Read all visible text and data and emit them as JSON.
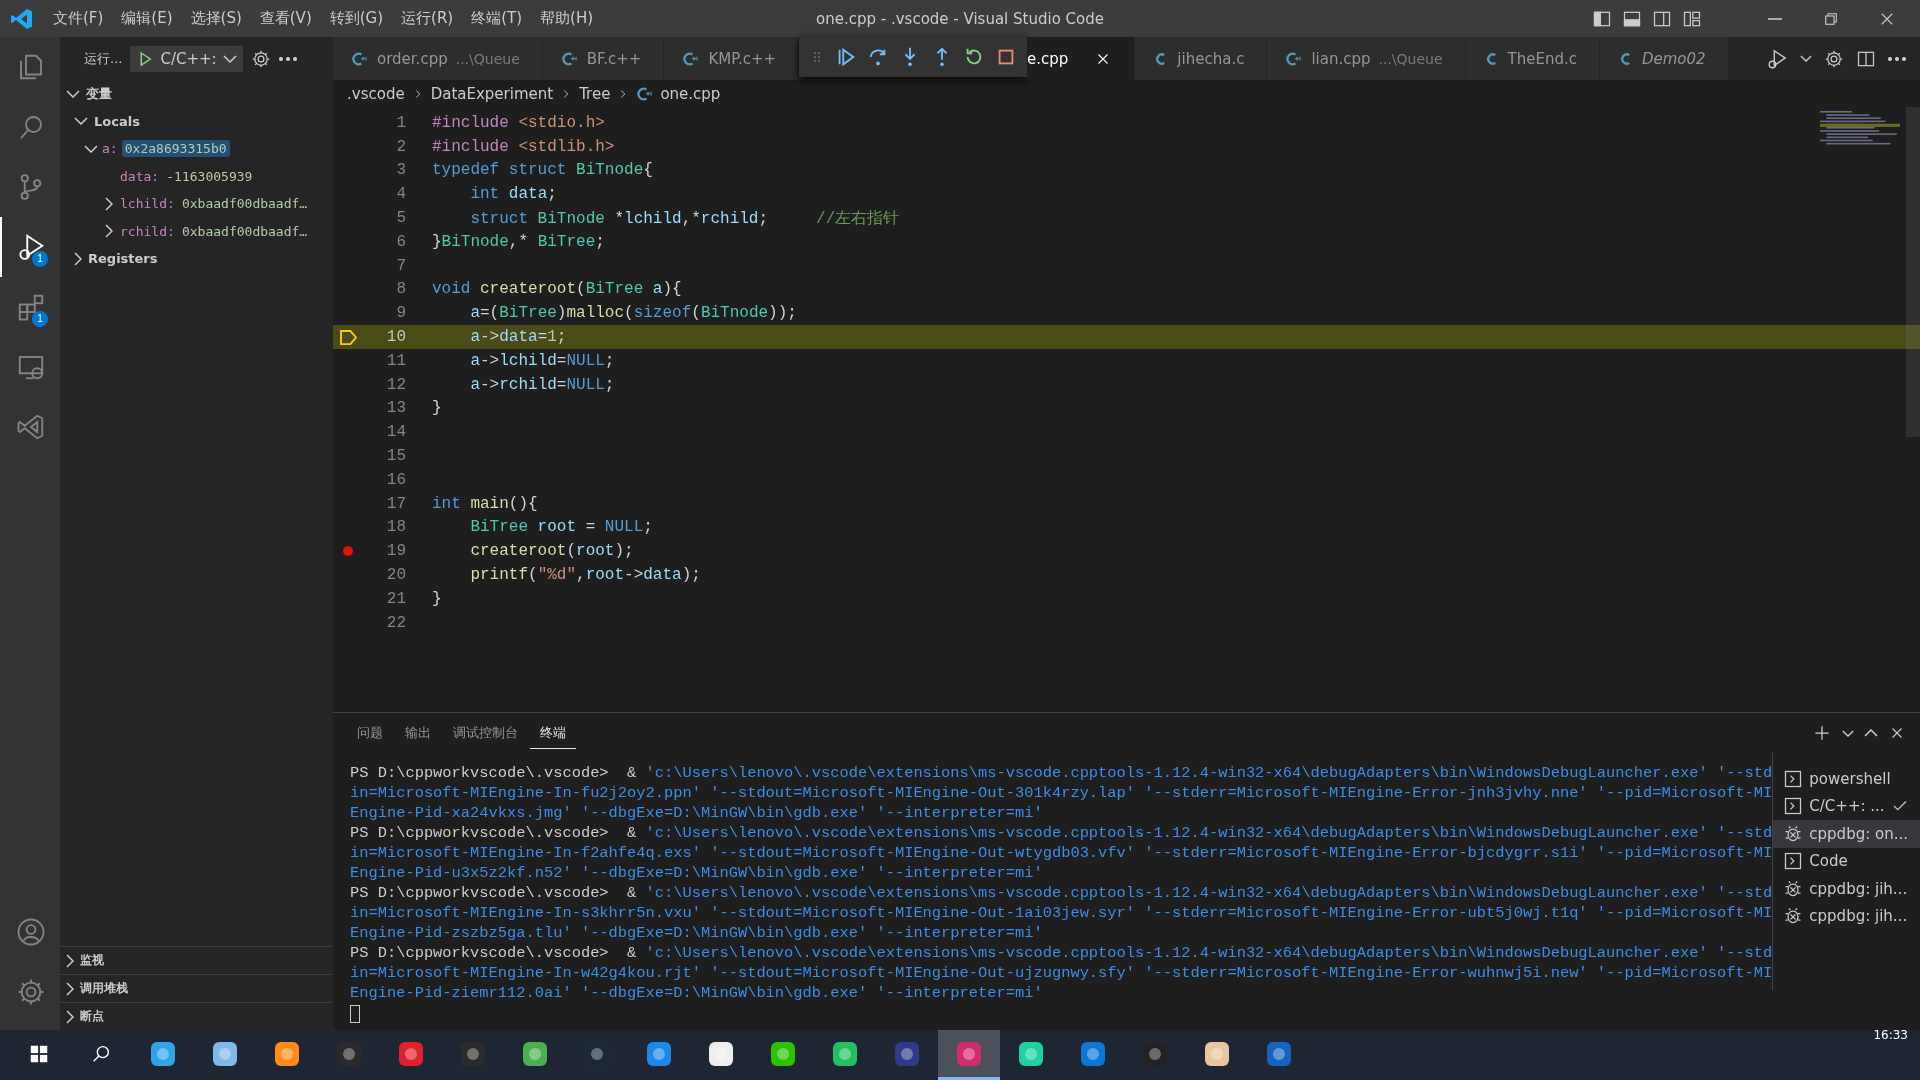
{
  "title_bar": {
    "menus": [
      "文件(F)",
      "编辑(E)",
      "选择(S)",
      "查看(V)",
      "转到(G)",
      "运行(R)",
      "终端(T)",
      "帮助(H)"
    ],
    "title": "one.cpp - .vscode - Visual Studio Code"
  },
  "activity_bar": {
    "items": [
      {
        "kind": "explorer",
        "selected": false
      },
      {
        "kind": "search",
        "selected": false
      },
      {
        "kind": "scm",
        "selected": false
      },
      {
        "kind": "debug",
        "selected": true,
        "badge": "1"
      },
      {
        "kind": "extensions",
        "selected": false,
        "badge": "1"
      },
      {
        "kind": "remote",
        "selected": false
      },
      {
        "kind": "vs",
        "selected": false
      }
    ],
    "bottom": [
      {
        "kind": "account"
      },
      {
        "kind": "settings"
      }
    ]
  },
  "run_header": {
    "title": "运行...",
    "config": "C/C++:"
  },
  "variables": {
    "title": "变量",
    "expanded": true,
    "scopes": [
      {
        "label": "Locals",
        "expanded": true,
        "children": [
          {
            "name": "a:",
            "value": "0x2a8693315b0",
            "expanded": true,
            "selected": true,
            "children": [
              {
                "name": "data:",
                "value": "-1163005939",
                "kind": "leaf",
                "selected": false
              },
              {
                "name": "lchild:",
                "value": "0xbaadf00dbaadf…",
                "kind": "node",
                "expanded": false,
                "selected": false
              },
              {
                "name": "rchild:",
                "value": "0xbaadf00dbaadf…",
                "kind": "node",
                "expanded": false,
                "selected": false
              }
            ]
          }
        ]
      },
      {
        "label": "Registers",
        "expanded": false
      }
    ]
  },
  "sections": [
    {
      "label": "监视",
      "expanded": false
    },
    {
      "label": "调用堆栈",
      "expanded": false
    },
    {
      "label": "断点",
      "expanded": false
    }
  ],
  "editor": {
    "tabs": [
      {
        "label": "order.cpp",
        "detail": "...\\Queue",
        "kind": "cpp",
        "selected": false
      },
      {
        "label": "BF.c++",
        "kind": "cpp",
        "selected": false
      },
      {
        "label": "KMP.c++",
        "kind": "cpp",
        "selected": false
      },
      {
        "label": "e.cpp",
        "kind": "hidden",
        "selected": true
      },
      {
        "label": "jihecha.c",
        "kind": "c",
        "selected": false
      },
      {
        "label": "lian.cpp",
        "detail": "...\\Queue",
        "kind": "cpp",
        "selected": false
      },
      {
        "label": "TheEnd.c",
        "kind": "c",
        "selected": false
      },
      {
        "label": "Demo02",
        "kind": "c",
        "selected": false,
        "italic": true
      }
    ],
    "breadcrumb": [
      ".vscode",
      "DataExperiment",
      "Tree",
      "one.cpp"
    ],
    "lines": [
      {
        "number": "1",
        "current": false,
        "breakpoint": false,
        "tokens": [
          {
            "text": "#include",
            "kind": "macro"
          },
          {
            "text": " <stdio.h>",
            "kind": "str"
          }
        ]
      },
      {
        "number": "2",
        "current": false,
        "breakpoint": false,
        "tokens": [
          {
            "text": "#include",
            "kind": "macro"
          },
          {
            "text": " <stdlib.h>",
            "kind": "str"
          }
        ]
      },
      {
        "number": "3",
        "current": false,
        "breakpoint": false,
        "tokens": [
          {
            "text": "typedef struct",
            "kind": "kw"
          },
          {
            "text": " BiTnode",
            "kind": "type"
          },
          {
            "text": "{",
            "kind": "plain"
          }
        ]
      },
      {
        "number": "4",
        "current": false,
        "breakpoint": false,
        "tokens": [
          {
            "text": "    int",
            "kind": "kw"
          },
          {
            "text": " data",
            "kind": "var"
          },
          {
            "text": ";",
            "kind": "plain"
          }
        ]
      },
      {
        "number": "5",
        "current": false,
        "breakpoint": false,
        "tokens": [
          {
            "text": "    struct",
            "kind": "kw"
          },
          {
            "text": " BiTnode",
            "kind": "type"
          },
          {
            "text": " *",
            "kind": "plain"
          },
          {
            "text": "lchild",
            "kind": "var"
          },
          {
            "text": ",*",
            "kind": "plain"
          },
          {
            "text": "rchild",
            "kind": "var"
          },
          {
            "text": ";",
            "kind": "plain"
          },
          {
            "text": "     //左右指针",
            "kind": "cmt"
          }
        ]
      },
      {
        "number": "6",
        "current": false,
        "breakpoint": false,
        "tokens": [
          {
            "text": "}",
            "kind": "plain"
          },
          {
            "text": "BiTnode",
            "kind": "type"
          },
          {
            "text": ",*",
            "kind": "plain"
          },
          {
            "text": " BiTree",
            "kind": "type"
          },
          {
            "text": ";",
            "kind": "plain"
          }
        ]
      },
      {
        "number": "7",
        "current": false,
        "breakpoint": false
      },
      {
        "number": "8",
        "current": false,
        "breakpoint": false,
        "tokens": [
          {
            "text": "void",
            "kind": "kw"
          },
          {
            "text": " createroot",
            "kind": "fn"
          },
          {
            "text": "(",
            "kind": "plain"
          },
          {
            "text": "BiTree",
            "kind": "type"
          },
          {
            "text": " a",
            "kind": "var"
          },
          {
            "text": "){",
            "kind": "plain"
          }
        ]
      },
      {
        "number": "9",
        "current": false,
        "breakpoint": false,
        "tokens": [
          {
            "text": "    a",
            "kind": "var"
          },
          {
            "text": "=(",
            "kind": "plain"
          },
          {
            "text": "BiTree",
            "kind": "type"
          },
          {
            "text": ")",
            "kind": "plain"
          },
          {
            "text": "malloc",
            "kind": "fn"
          },
          {
            "text": "(",
            "kind": "plain"
          },
          {
            "text": "sizeof",
            "kind": "kw"
          },
          {
            "text": "(",
            "kind": "plain"
          },
          {
            "text": "BiTnode",
            "kind": "type"
          },
          {
            "text": "));",
            "kind": "plain"
          }
        ]
      },
      {
        "number": "10",
        "current": true,
        "breakpoint": false,
        "tokens": [
          {
            "text": "    a",
            "kind": "var"
          },
          {
            "text": "->",
            "kind": "plain"
          },
          {
            "text": "data",
            "kind": "var"
          },
          {
            "text": "=",
            "kind": "plain"
          },
          {
            "text": "1",
            "kind": "num"
          },
          {
            "text": ";",
            "kind": "plain"
          }
        ]
      },
      {
        "number": "11",
        "current": false,
        "breakpoint": false,
        "tokens": [
          {
            "text": "    a",
            "kind": "var"
          },
          {
            "text": "->",
            "kind": "plain"
          },
          {
            "text": "lchild",
            "kind": "var"
          },
          {
            "text": "=",
            "kind": "plain"
          },
          {
            "text": "NULL",
            "kind": "kw"
          },
          {
            "text": ";",
            "kind": "plain"
          }
        ]
      },
      {
        "number": "12",
        "current": false,
        "breakpoint": false,
        "tokens": [
          {
            "text": "    a",
            "kind": "var"
          },
          {
            "text": "->",
            "kind": "plain"
          },
          {
            "text": "rchild",
            "kind": "var"
          },
          {
            "text": "=",
            "kind": "plain"
          },
          {
            "text": "NULL",
            "kind": "kw"
          },
          {
            "text": ";",
            "kind": "plain"
          }
        ]
      },
      {
        "number": "13",
        "current": false,
        "breakpoint": false,
        "tokens": [
          {
            "text": "}",
            "kind": "plain"
          }
        ]
      },
      {
        "number": "14",
        "current": false,
        "breakpoint": false
      },
      {
        "number": "15",
        "current": false,
        "breakpoint": false
      },
      {
        "number": "16",
        "current": false,
        "breakpoint": false
      },
      {
        "number": "17",
        "current": false,
        "breakpoint": false,
        "tokens": [
          {
            "text": "int",
            "kind": "kw"
          },
          {
            "text": " main",
            "kind": "fn"
          },
          {
            "text": "(){",
            "kind": "plain"
          }
        ]
      },
      {
        "number": "18",
        "current": false,
        "breakpoint": false,
        "tokens": [
          {
            "text": "    BiTree",
            "kind": "type"
          },
          {
            "text": " root",
            "kind": "var"
          },
          {
            "text": " =",
            "kind": "plain"
          },
          {
            "text": " NULL",
            "kind": "kw"
          },
          {
            "text": ";",
            "kind": "plain"
          }
        ]
      },
      {
        "number": "19",
        "current": false,
        "breakpoint": true,
        "tokens": [
          {
            "text": "    createroot",
            "kind": "fn"
          },
          {
            "text": "(",
            "kind": "plain"
          },
          {
            "text": "root",
            "kind": "var"
          },
          {
            "text": ");",
            "kind": "plain"
          }
        ]
      },
      {
        "number": "20",
        "current": false,
        "breakpoint": false,
        "tokens": [
          {
            "text": "    printf",
            "kind": "fn"
          },
          {
            "text": "(",
            "kind": "plain"
          },
          {
            "text": "\"%d\"",
            "kind": "str"
          },
          {
            "text": ",",
            "kind": "plain"
          },
          {
            "text": "root",
            "kind": "var"
          },
          {
            "text": "->",
            "kind": "plain"
          },
          {
            "text": "data",
            "kind": "var"
          },
          {
            "text": ");",
            "kind": "plain"
          }
        ]
      },
      {
        "number": "21",
        "current": false,
        "breakpoint": false,
        "tokens": [
          {
            "text": "}",
            "kind": "plain"
          }
        ]
      },
      {
        "number": "22",
        "current": false,
        "breakpoint": false
      }
    ]
  },
  "panel": {
    "tabs": [
      {
        "label": "问题",
        "selected": false
      },
      {
        "label": "输出",
        "selected": false
      },
      {
        "label": "调试控制台",
        "selected": false
      },
      {
        "label": "终端",
        "selected": true
      }
    ],
    "terminal_lines": [
      {
        "prompt": "PS D:\\cppworkvscode\\.vscode>  &",
        "text": " 'c:\\Users\\lenovo\\.vscode\\extensions\\ms-vscode.cpptools-1.12.4-win32-x64\\debugAdapters\\bin\\WindowsDebugLauncher.exe' '--std"
      },
      {
        "text": "in=Microsoft-MIEngine-In-fu2j2oy2.ppn' '--stdout=Microsoft-MIEngine-Out-301k4rzy.lap' '--stderr=Microsoft-MIEngine-Error-jnh3jvhy.nne' '--pid=Microsoft-MI"
      },
      {
        "text": "Engine-Pid-xa24vkxs.jmg' '--dbgExe=D:\\MinGW\\bin\\gdb.exe' '--interpreter=mi'"
      },
      {
        "prompt": "PS D:\\cppworkvscode\\.vscode>  &",
        "text": " 'c:\\Users\\lenovo\\.vscode\\extensions\\ms-vscode.cpptools-1.12.4-win32-x64\\debugAdapters\\bin\\WindowsDebugLauncher.exe' '--std"
      },
      {
        "text": "in=Microsoft-MIEngine-In-f2ahfe4q.exs' '--stdout=Microsoft-MIEngine-Out-wtygdb03.vfv' '--stderr=Microsoft-MIEngine-Error-bjcdygrr.s1i' '--pid=Microsoft-MI"
      },
      {
        "text": "Engine-Pid-u3x5z2kf.n52' '--dbgExe=D:\\MinGW\\bin\\gdb.exe' '--interpreter=mi'"
      },
      {
        "prompt": "PS D:\\cppworkvscode\\.vscode>  &",
        "text": " 'c:\\Users\\lenovo\\.vscode\\extensions\\ms-vscode.cpptools-1.12.4-win32-x64\\debugAdapters\\bin\\WindowsDebugLauncher.exe' '--std"
      },
      {
        "text": "in=Microsoft-MIEngine-In-s3khrr5n.vxu' '--stdout=Microsoft-MIEngine-Out-1ai03jew.syr' '--stderr=Microsoft-MIEngine-Error-ubt5j0wj.t1q' '--pid=Microsoft-MI"
      },
      {
        "text": "Engine-Pid-zszbz5ga.tlu' '--dbgExe=D:\\MinGW\\bin\\gdb.exe' '--interpreter=mi'"
      },
      {
        "prompt": "PS D:\\cppworkvscode\\.vscode>  &",
        "text": " 'c:\\Users\\lenovo\\.vscode\\extensions\\ms-vscode.cpptools-1.12.4-win32-x64\\debugAdapters\\bin\\WindowsDebugLauncher.exe' '--std"
      },
      {
        "text": "in=Microsoft-MIEngine-In-w42g4kou.rjt' '--stdout=Microsoft-MIEngine-Out-ujzugnwy.sfy' '--stderr=Microsoft-MIEngine-Error-wuhnwj5i.new' '--pid=Microsoft-MI"
      },
      {
        "text": "Engine-Pid-ziemr112.0ai' '--dbgExe=D:\\MinGW\\bin\\gdb.exe' '--interpreter=mi'"
      }
    ],
    "terminals": [
      {
        "label": "powershell",
        "kind": "shell",
        "selected": false,
        "checked": false
      },
      {
        "label": "C/C++: ...",
        "kind": "shell",
        "selected": false,
        "checked": true
      },
      {
        "label": "cppdbg: on...",
        "kind": "debug",
        "selected": true,
        "checked": false
      },
      {
        "label": "Code",
        "kind": "shell",
        "selected": false,
        "checked": false
      },
      {
        "label": "cppdbg: jih...",
        "kind": "debug",
        "selected": false,
        "checked": false
      },
      {
        "label": "cppdbg: jih...",
        "kind": "debug",
        "selected": false,
        "checked": false
      }
    ]
  },
  "taskbar": {
    "apps": [
      {
        "selected": false
      },
      {
        "selected": false
      },
      {
        "selected": false
      },
      {
        "selected": false
      },
      {
        "selected": false
      },
      {
        "selected": false
      },
      {
        "selected": false
      },
      {
        "selected": false
      },
      {
        "selected": false
      },
      {
        "selected": false
      },
      {
        "selected": false
      },
      {
        "selected": false
      },
      {
        "selected": false
      },
      {
        "selected": false
      },
      {
        "selected": false
      },
      {
        "selected": true
      },
      {
        "selected": false
      },
      {
        "selected": false
      },
      {
        "selected": false
      },
      {
        "selected": false
      },
      {
        "selected": false
      }
    ],
    "clock": "16:33"
  }
}
